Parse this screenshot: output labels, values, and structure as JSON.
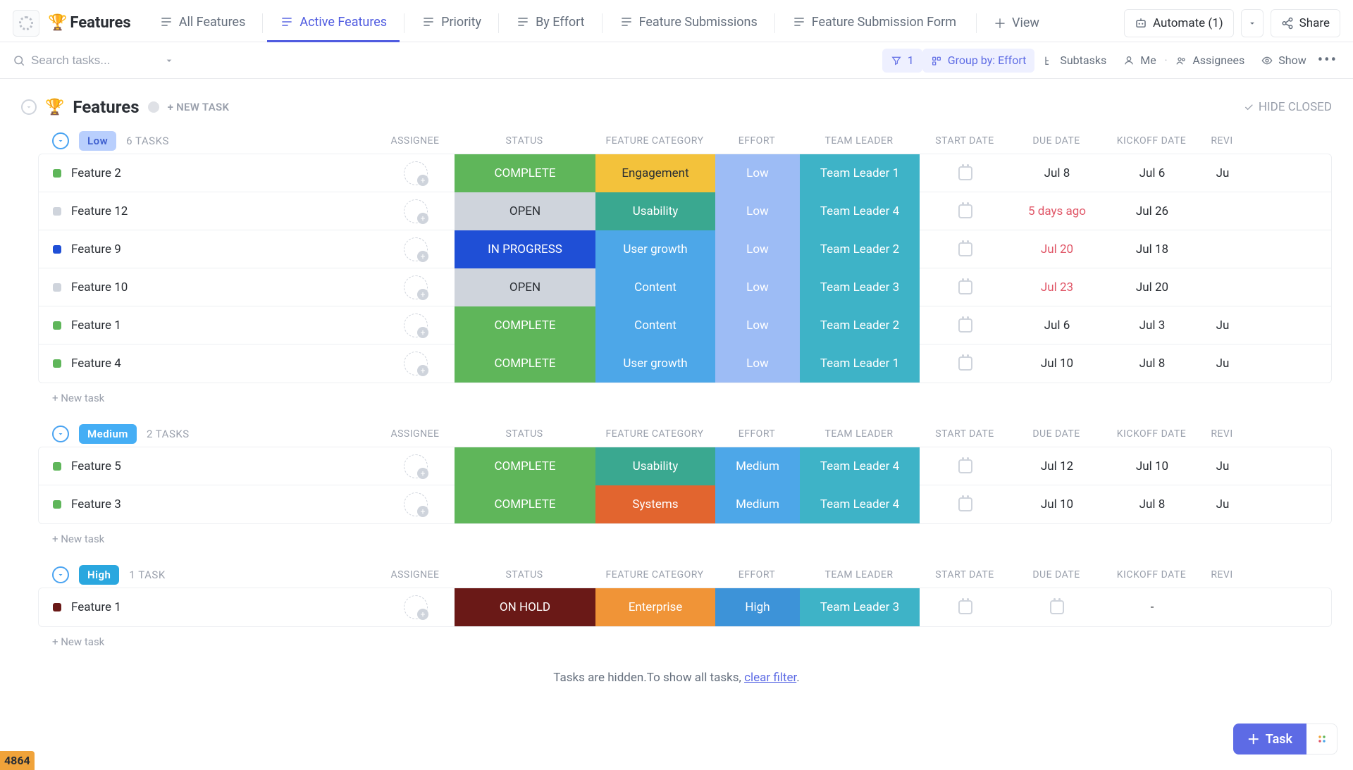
{
  "nav": {
    "title": "Features",
    "tabs": [
      {
        "label": "All Features",
        "active": false
      },
      {
        "label": "Active Features",
        "active": true
      },
      {
        "label": "Priority",
        "active": false
      },
      {
        "label": "By Effort",
        "active": false
      },
      {
        "label": "Feature Submissions",
        "active": false
      },
      {
        "label": "Feature Submission Form",
        "active": false
      }
    ],
    "add_view_label": "View",
    "automate_label": "Automate (1)",
    "share_label": "Share"
  },
  "toolbar": {
    "search_placeholder": "Search tasks...",
    "filter_count": "1",
    "group_by_label": "Group by: Effort",
    "subtasks_label": "Subtasks",
    "me_label": "Me",
    "assignees_label": "Assignees",
    "show_label": "Show"
  },
  "header": {
    "list_title": "Features",
    "new_task": "+ NEW TASK",
    "hide_closed": "HIDE CLOSED"
  },
  "columns": {
    "assignee": "ASSIGNEE",
    "status": "STATUS",
    "feature_category": "FEATURE CATEGORY",
    "effort": "EFFORT",
    "team_leader": "TEAM LEADER",
    "start_date": "START DATE",
    "due_date": "DUE DATE",
    "kickoff_date": "KICKOFF DATE",
    "review": "REVI"
  },
  "groups": [
    {
      "name": "Low",
      "chip_class": "low",
      "count": "6 TASKS",
      "new_task": "+ New task",
      "rows": [
        {
          "bullet": "green",
          "name": "Feature 2",
          "status": "COMPLETE",
          "status_class": "c-complete",
          "cat": "Engagement",
          "cat_class": "c-engagement",
          "effort": "Low",
          "effort_class": "c-low",
          "leader": "Team Leader 1",
          "due": "Jul 8",
          "due_red": false,
          "kick": "Jul 6",
          "rev": "Ju"
        },
        {
          "bullet": "grey",
          "name": "Feature 12",
          "status": "OPEN",
          "status_class": "c-open",
          "cat": "Usability",
          "cat_class": "c-usability",
          "effort": "Low",
          "effort_class": "c-low",
          "leader": "Team Leader 4",
          "due": "5 days ago",
          "due_red": true,
          "kick": "Jul 26",
          "rev": ""
        },
        {
          "bullet": "blue",
          "name": "Feature 9",
          "status": "IN PROGRESS",
          "status_class": "c-inprogress",
          "cat": "User growth",
          "cat_class": "c-usergrowth",
          "effort": "Low",
          "effort_class": "c-low",
          "leader": "Team Leader 2",
          "due": "Jul 20",
          "due_red": true,
          "kick": "Jul 18",
          "rev": ""
        },
        {
          "bullet": "grey",
          "name": "Feature 10",
          "status": "OPEN",
          "status_class": "c-open",
          "cat": "Content",
          "cat_class": "c-content",
          "effort": "Low",
          "effort_class": "c-low",
          "leader": "Team Leader 3",
          "due": "Jul 23",
          "due_red": true,
          "kick": "Jul 20",
          "rev": ""
        },
        {
          "bullet": "green",
          "name": "Feature 1",
          "status": "COMPLETE",
          "status_class": "c-complete",
          "cat": "Content",
          "cat_class": "c-content",
          "effort": "Low",
          "effort_class": "c-low",
          "leader": "Team Leader 2",
          "due": "Jul 6",
          "due_red": false,
          "kick": "Jul 3",
          "rev": "Ju"
        },
        {
          "bullet": "green",
          "name": "Feature 4",
          "status": "COMPLETE",
          "status_class": "c-complete",
          "cat": "User growth",
          "cat_class": "c-usergrowth",
          "effort": "Low",
          "effort_class": "c-low",
          "leader": "Team Leader 1",
          "due": "Jul 10",
          "due_red": false,
          "kick": "Jul 8",
          "rev": "Ju"
        }
      ]
    },
    {
      "name": "Medium",
      "chip_class": "medium",
      "count": "2 TASKS",
      "new_task": "+ New task",
      "rows": [
        {
          "bullet": "green",
          "name": "Feature 5",
          "status": "COMPLETE",
          "status_class": "c-complete",
          "cat": "Usability",
          "cat_class": "c-usability",
          "effort": "Medium",
          "effort_class": "c-medium",
          "leader": "Team Leader 4",
          "due": "Jul 12",
          "due_red": false,
          "kick": "Jul 10",
          "rev": "Ju"
        },
        {
          "bullet": "green",
          "name": "Feature 3",
          "status": "COMPLETE",
          "status_class": "c-complete",
          "cat": "Systems",
          "cat_class": "c-systems",
          "effort": "Medium",
          "effort_class": "c-medium",
          "leader": "Team Leader 4",
          "due": "Jul 10",
          "due_red": false,
          "kick": "Jul 8",
          "rev": "Ju"
        }
      ]
    },
    {
      "name": "High",
      "chip_class": "high",
      "count": "1 TASK",
      "new_task": "+ New task",
      "rows": [
        {
          "bullet": "darkred",
          "name": "Feature 1",
          "status": "ON HOLD",
          "status_class": "c-onhold",
          "cat": "Enterprise",
          "cat_class": "c-enterprise",
          "effort": "High",
          "effort_class": "c-high",
          "leader": "Team Leader 3",
          "due": "",
          "due_red": false,
          "due_cal": true,
          "kick": "-",
          "rev": ""
        }
      ]
    }
  ],
  "footer": {
    "hidden_text": "Tasks are hidden.To show all tasks, ",
    "clear_filter": "clear filter",
    "task_button": "Task",
    "badge": "4864"
  }
}
